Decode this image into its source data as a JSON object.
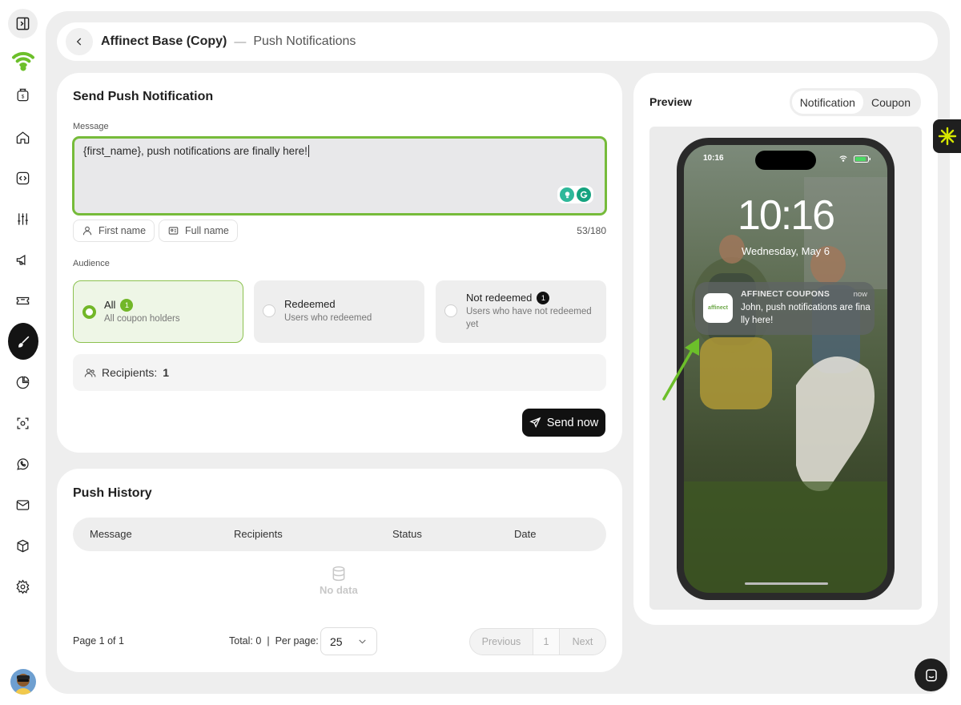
{
  "header": {
    "title": "Affinect Base (Copy)",
    "separator": "—",
    "subtitle": "Push Notifications"
  },
  "sidebar": {
    "items": [
      {
        "name": "sidebar-toggle",
        "icon": "panel-toggle-icon"
      },
      {
        "name": "wifi-logo",
        "icon": "wifi-icon"
      },
      {
        "name": "billing",
        "icon": "money-bag-icon"
      },
      {
        "name": "home",
        "icon": "home-icon"
      },
      {
        "name": "code",
        "icon": "code-icon"
      },
      {
        "name": "settings-sliders",
        "icon": "sliders-icon"
      },
      {
        "name": "campaigns",
        "icon": "megaphone-icon"
      },
      {
        "name": "coupons",
        "icon": "ticket-icon"
      },
      {
        "name": "design",
        "icon": "brush-icon",
        "active": true
      },
      {
        "name": "analytics",
        "icon": "pie-chart-icon"
      },
      {
        "name": "scan",
        "icon": "scan-icon"
      },
      {
        "name": "whatsapp",
        "icon": "whatsapp-icon"
      },
      {
        "name": "email",
        "icon": "mail-icon"
      },
      {
        "name": "packages",
        "icon": "box-icon"
      },
      {
        "name": "settings",
        "icon": "gear-icon"
      }
    ]
  },
  "send": {
    "title": "Send Push Notification",
    "message_label": "Message",
    "message_value": "{first_name}, push notifications are finally here!",
    "chips": {
      "first_name": "First name",
      "full_name": "Full name"
    },
    "counter": "53/180",
    "audience_label": "Audience",
    "audience": [
      {
        "title": "All",
        "badge": "1",
        "desc": "All coupon holders",
        "selected": true
      },
      {
        "title": "Redeemed",
        "desc": "Users who redeemed",
        "selected": false
      },
      {
        "title": "Not redeemed",
        "badge": "1",
        "desc": "Users who have not redeemed yet",
        "selected": false
      }
    ],
    "recipients_label": "Recipients:",
    "recipients_count": "1",
    "send_button": "Send now"
  },
  "history": {
    "title": "Push History",
    "columns": [
      "Message",
      "Recipients",
      "Status",
      "Date"
    ],
    "empty_text": "No data",
    "page_info": "Page 1 of 1",
    "total": "Total: 0",
    "per_page_label": "Per page:",
    "per_page_value": "25",
    "pager": {
      "previous": "Previous",
      "current": "1",
      "next": "Next"
    }
  },
  "preview": {
    "title": "Preview",
    "tabs": [
      {
        "label": "Notification",
        "active": true
      },
      {
        "label": "Coupon",
        "active": false
      }
    ],
    "status_time": "10:16",
    "lock_time": "10:16",
    "lock_date": "Wednesday, May 6",
    "notification": {
      "app": "AFFINECT COUPONS",
      "time": "now",
      "body": "John, push notifications are finally here!",
      "icon_text": "affinect"
    }
  },
  "colors": {
    "accent_green": "#76bb3a",
    "dark": "#111111",
    "background": "#eeeeee"
  }
}
